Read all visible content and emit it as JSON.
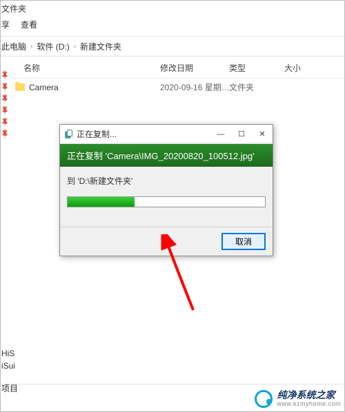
{
  "window": {
    "title": "文件夹"
  },
  "menu": {
    "share": "享",
    "view": "查看"
  },
  "breadcrumb": {
    "root": "此电脑",
    "drive": "软件 (D:)",
    "folder": "新建文件夹"
  },
  "columns": {
    "name": "名称",
    "date": "修改日期",
    "type": "类型",
    "size": "大小"
  },
  "rows": [
    {
      "name": "Camera",
      "date": "2020-09-16 星期…",
      "type": "文件夹"
    }
  ],
  "dialog": {
    "title": "正在复制...",
    "banner_prefix": "正在复制 '",
    "banner_file": "Camera\\IMG_20200820_100512.jpg",
    "banner_suffix": "'",
    "dest_prefix": "到 '",
    "dest_path": "D:\\新建文件夹",
    "dest_suffix": "'",
    "cancel": "取消"
  },
  "bottom": {
    "item1": "HiS",
    "item2": "iSui",
    "status": "项目"
  },
  "watermark": {
    "main": "纯净系统之家",
    "sub": "www.kzmyhome.com"
  }
}
